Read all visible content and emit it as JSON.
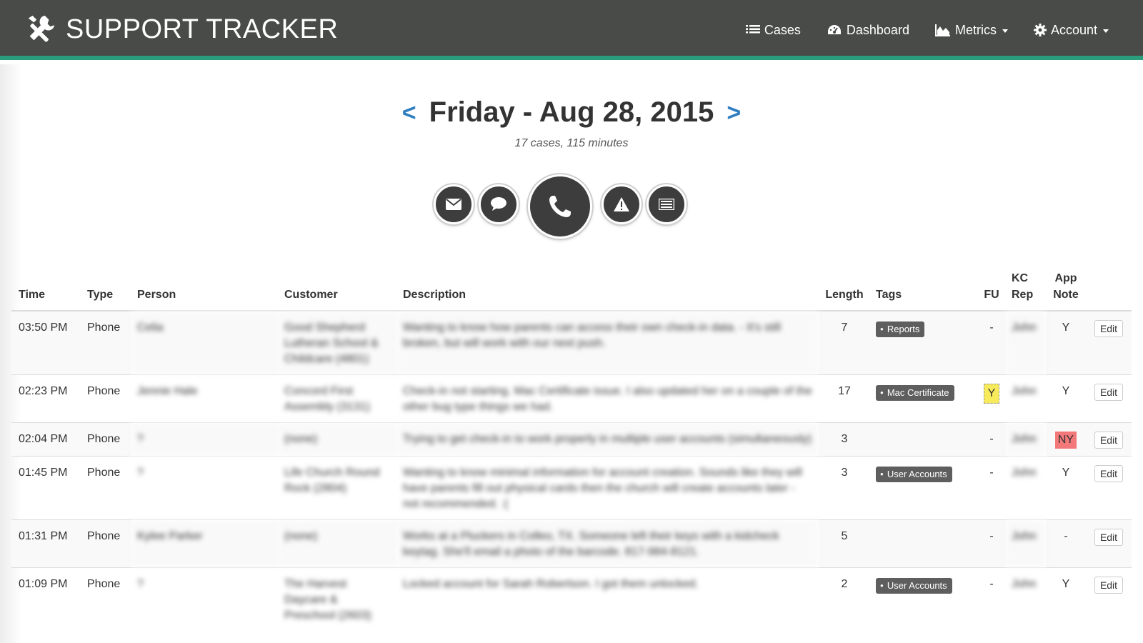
{
  "app": {
    "title": "SUPPORT TRACKER"
  },
  "nav": {
    "cases": "Cases",
    "dashboard": "Dashboard",
    "metrics": "Metrics",
    "account": "Account"
  },
  "header": {
    "prev": "<",
    "next": ">",
    "date": "Friday - Aug 28, 2015",
    "summary": "17 cases, 115 minutes"
  },
  "filters": [
    {
      "name": "email",
      "icon": "envelope-icon"
    },
    {
      "name": "chat",
      "icon": "speech-bubble-icon"
    },
    {
      "name": "phone",
      "icon": "phone-icon",
      "active": true
    },
    {
      "name": "alert",
      "icon": "warning-icon"
    },
    {
      "name": "other",
      "icon": "list-box-icon"
    }
  ],
  "table": {
    "headers": {
      "time": "Time",
      "type": "Type",
      "person": "Person",
      "customer": "Customer",
      "description": "Description",
      "length": "Length",
      "tags": "Tags",
      "fu": "FU",
      "kc_rep_1": "KC",
      "kc_rep_2": "Rep",
      "app_note_1": "App",
      "app_note_2": "Note"
    },
    "rows": [
      {
        "time": "03:50 PM",
        "type": "Phone",
        "person": "Celia",
        "customer": "Good Shepherd Lutheran School & Childcare (4801)",
        "description": "Wanting to know how parents can access their own check-in data. - It's still broken, but will work with our next push.",
        "length": "7",
        "tag": "Reports",
        "fu": "-",
        "rep": "John",
        "app_note": "Y",
        "edit": "Edit"
      },
      {
        "time": "02:23 PM",
        "type": "Phone",
        "person": "Jennie Hale",
        "customer": "Concord First Assembly (3131)",
        "description": "Check-in not starting. Mac Certificate issue. I also updated her on a couple of the other bug type things we had.",
        "length": "17",
        "tag": "Mac Certificate",
        "fu": "Y",
        "rep": "John",
        "app_note": "Y",
        "edit": "Edit"
      },
      {
        "time": "02:04 PM",
        "type": "Phone",
        "person": "?",
        "customer": "(none)",
        "description": "Trying to get check-in to work properly in multiple user accounts (simultaneously)",
        "length": "3",
        "tag": "",
        "fu": "-",
        "rep": "John",
        "app_note": "NY",
        "edit": "Edit"
      },
      {
        "time": "01:45 PM",
        "type": "Phone",
        "person": "?",
        "customer": "Life Church Round Rock (2804)",
        "description": "Wanting to know minimal information for account creation. Sounds like they will have parents fill out physical cards then the church will create accounts later - not recommended. :(",
        "length": "3",
        "tag": "User Accounts",
        "fu": "-",
        "rep": "John",
        "app_note": "Y",
        "edit": "Edit"
      },
      {
        "time": "01:31 PM",
        "type": "Phone",
        "person": "Kylee Parker",
        "customer": "(none)",
        "description": "Works at a Pluckers in Colleo, TX. Someone left their keys with a kidcheck keytag. She'll email a photo of the barcode. 817-984-8121.",
        "length": "5",
        "tag": "",
        "fu": "-",
        "rep": "John",
        "app_note": "-",
        "edit": "Edit"
      },
      {
        "time": "01:09 PM",
        "type": "Phone",
        "person": "?",
        "customer": "The Harvest Daycare & Preschool (2603)",
        "description": "Locked account for Sarah Robertson. I got them unlocked.",
        "length": "2",
        "tag": "User Accounts",
        "fu": "-",
        "rep": "John",
        "app_note": "Y",
        "edit": "Edit"
      }
    ]
  },
  "colors": {
    "navbar": "#484b48",
    "accent_bar": "#2a9d7c",
    "link": "#2f7fc1",
    "tag_bg": "#5e5e5e",
    "fu_highlight": "#f7ea5b",
    "app_note_flag": "#f2787a"
  }
}
